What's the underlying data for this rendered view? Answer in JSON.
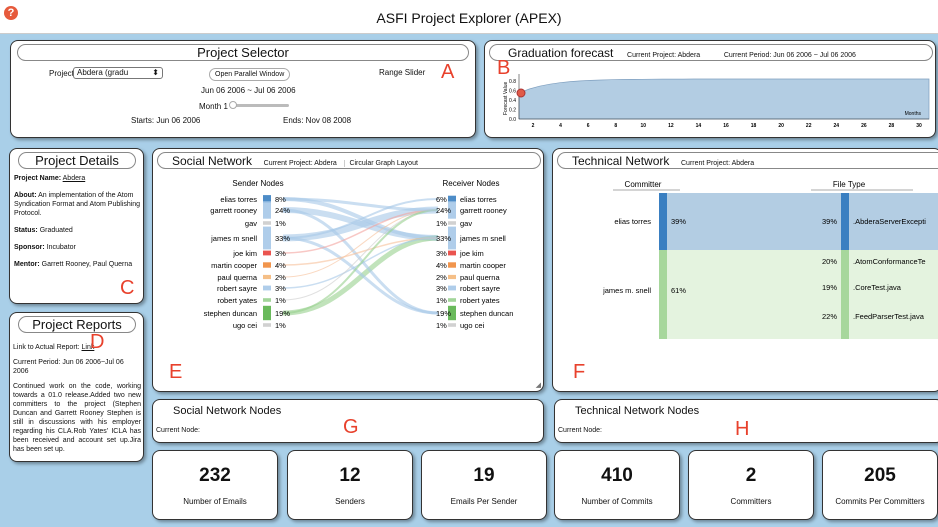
{
  "app": {
    "title": "ASFI Project Explorer (APEX)"
  },
  "letters": {
    "a": "A",
    "b": "B",
    "c": "C",
    "d": "D",
    "e": "E",
    "f": "F",
    "g": "G",
    "h": "H"
  },
  "selector": {
    "title": "Project Selector",
    "project_label": "Project",
    "project_value": "Abdera (gradu",
    "open_button": "Open Parallel Window",
    "range_label": "Range Slider",
    "range": "Jun 06 2006 ~ Jul 06 2006",
    "month_label": "Month 1",
    "starts": "Starts: Jun 06 2006",
    "ends": "Ends: Nov 08 2008"
  },
  "forecast": {
    "title": "Graduation forecast",
    "project": "Current Project:  Abdera",
    "period": "Current Period:  Jun 06 2006 ~ Jul 06 2006",
    "ylabel": "Forecast Value",
    "xlabel": "Months",
    "yticks": [
      "0.8",
      "0.6",
      "0.4",
      "0.2",
      "0.0"
    ],
    "xticks": [
      "2",
      "4",
      "6",
      "8",
      "10",
      "12",
      "14",
      "16",
      "18",
      "20",
      "22",
      "24",
      "26",
      "28",
      "30"
    ]
  },
  "details": {
    "title": "Project Details",
    "name_label": "Project Name:",
    "name": "Abdera",
    "about_label": "About:",
    "about": "An implementation of the Atom Syndication Format and Atom Publishing Protocol.",
    "status_label": "Status:",
    "status": "Graduated",
    "sponsor_label": "Sponsor:",
    "sponsor": "Incubator",
    "mentor_label": "Mentor:",
    "mentor": "Garrett Rooney, Paul Querna"
  },
  "reports": {
    "title": "Project Reports",
    "link_label": "Link to Actual Report:",
    "link": "Link",
    "period": "Current Period:  Jun 06 2006~Jul 06 2006",
    "text": "Continued work on the code, working towards a 01.0 release.Added two new committers to the project (Stephen Duncan and Garrett Rooney Stephen is still in discussions with his employer regarding his CLA.Rob Yates' ICLA has been received and account set up.Jira has been set up."
  },
  "social": {
    "title": "Social Network",
    "project": "Current Project:  Abdera",
    "toggle": "Circular Graph Layout",
    "sender_header": "Sender Nodes",
    "receiver_header": "Receiver Nodes",
    "senders": [
      {
        "name": "elias torres",
        "pct": "8%"
      },
      {
        "name": "garrett rooney",
        "pct": "24%"
      },
      {
        "name": "gav",
        "pct": "1%"
      },
      {
        "name": "james m snell",
        "pct": "33%"
      },
      {
        "name": "joe kim",
        "pct": "3%"
      },
      {
        "name": "martin cooper",
        "pct": "4%"
      },
      {
        "name": "paul querna",
        "pct": "2%"
      },
      {
        "name": "robert sayre",
        "pct": "3%"
      },
      {
        "name": "robert yates",
        "pct": "1%"
      },
      {
        "name": "stephen duncan",
        "pct": "19%"
      },
      {
        "name": "ugo cei",
        "pct": "1%"
      }
    ],
    "receivers": [
      {
        "name": "elias torres",
        "pct": "6%"
      },
      {
        "name": "garrett rooney",
        "pct": "24%"
      },
      {
        "name": "gav",
        "pct": "1%"
      },
      {
        "name": "james m snell",
        "pct": "33%"
      },
      {
        "name": "joe kim",
        "pct": "3%"
      },
      {
        "name": "martin cooper",
        "pct": "4%"
      },
      {
        "name": "paul querna",
        "pct": "2%"
      },
      {
        "name": "robert sayre",
        "pct": "3%"
      },
      {
        "name": "robert yates",
        "pct": "1%"
      },
      {
        "name": "stephen duncan",
        "pct": "19%"
      },
      {
        "name": "ugo cei",
        "pct": "1%"
      }
    ]
  },
  "technical": {
    "title": "Technical Network",
    "project": "Current Project:  Abdera",
    "committer_header": "Committer",
    "filetype_header": "File Type",
    "committers": [
      {
        "name": "elias torres",
        "pct": "39%"
      },
      {
        "name": "james m. snell",
        "pct": "61%"
      }
    ],
    "files": [
      {
        "name": ".AbderaServerExcepti",
        "pct": "39%"
      },
      {
        "name": ".AtomConformanceTe",
        "pct": "20%"
      },
      {
        "name": ".CoreTest.java",
        "pct": "19%"
      },
      {
        "name": ".FeedParserTest.java",
        "pct": "22%"
      }
    ]
  },
  "social_nodes": {
    "title": "Social Network Nodes",
    "current": "Current Node:"
  },
  "tech_nodes": {
    "title": "Technical Network Nodes",
    "current": "Current Node:"
  },
  "stats": [
    {
      "value": "232",
      "label": "Number of Emails"
    },
    {
      "value": "12",
      "label": "Senders"
    },
    {
      "value": "19",
      "label": "Emails Per Sender"
    },
    {
      "value": "410",
      "label": "Number of Commits"
    },
    {
      "value": "2",
      "label": "Committers"
    },
    {
      "value": "205",
      "label": "Commits Per Committers"
    }
  ]
}
